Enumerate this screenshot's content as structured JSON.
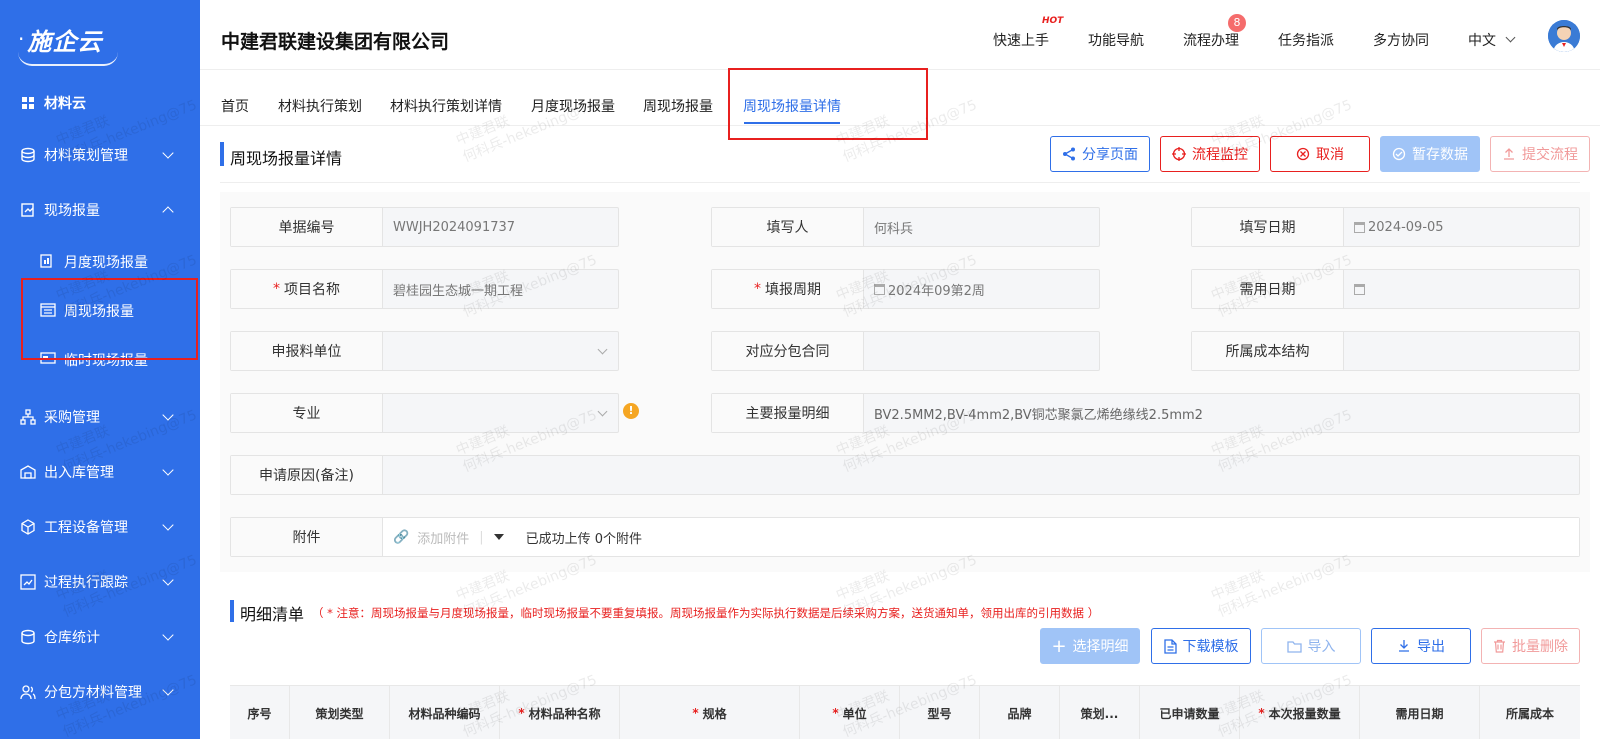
{
  "sidebar": {
    "logo": "施企云",
    "items": [
      {
        "label": "材料云"
      },
      {
        "label": "材料策划管理"
      },
      {
        "label": "现场报量"
      },
      {
        "label": "月度现场报量"
      },
      {
        "label": "周现场报量"
      },
      {
        "label": "临时现场报量"
      },
      {
        "label": "采购管理"
      },
      {
        "label": "出入库管理"
      },
      {
        "label": "工程设备管理"
      },
      {
        "label": "过程执行跟踪"
      },
      {
        "label": "仓库统计"
      },
      {
        "label": "分包方材料管理"
      }
    ]
  },
  "header": {
    "company": "中建君联建设集团有限公司",
    "nav": [
      "快速上手",
      "功能导航",
      "流程办理",
      "任务指派",
      "多方协同"
    ],
    "hot": "HOT",
    "badge": "8",
    "language": "中文"
  },
  "tabs": [
    "首页",
    "材料执行策划",
    "材料执行策划详情",
    "月度现场报量",
    "周现场报量",
    "周现场报量详情"
  ],
  "page": {
    "title": "周现场报量详情",
    "buttons": {
      "share": "分享页面",
      "monitor": "流程监控",
      "cancel": "取消",
      "save": "暂存数据",
      "submit": "提交流程"
    }
  },
  "form": {
    "doc_no": {
      "label": "单据编号",
      "value": "WWJH2024091737"
    },
    "filler": {
      "label": "填写人",
      "value": "何科兵"
    },
    "fill_date": {
      "label": "填写日期",
      "value": "2024-09-05"
    },
    "project": {
      "label": "项目名称",
      "value": "碧桂园生态城一期工程"
    },
    "period": {
      "label": "填报周期",
      "value": "2024年09第2周"
    },
    "need_date": {
      "label": "需用日期",
      "value": ""
    },
    "unit": {
      "label": "申报料单位",
      "value": ""
    },
    "contract": {
      "label": "对应分包合同",
      "value": ""
    },
    "cost": {
      "label": "所属成本结构",
      "value": ""
    },
    "major": {
      "label": "专业",
      "value": ""
    },
    "main_detail": {
      "label": "主要报量明细",
      "value": "BV2.5MM2,BV-4mm2,BV铜芯聚氯乙烯绝缘线2.5mm2"
    },
    "reason": {
      "label": "申请原因(备注)",
      "value": ""
    },
    "attach": {
      "label": "附件",
      "add": "添加附件",
      "status": "已成功上传 0个附件"
    }
  },
  "detail": {
    "title": "明细清单",
    "note": "（ * 注意：周现场报量与月度现场报量，临时现场报量不要重复填报。周现场报量作为实际执行数据是后续采购方案，送货通知单，领用出库的引用数据 ）",
    "buttons": {
      "select": "选择明细",
      "download": "下载模板",
      "import": "导入",
      "export": "导出",
      "batch_delete": "批量删除"
    },
    "columns": [
      "序号",
      "策划类型",
      "材料品种编码",
      "材料品种名称",
      "规格",
      "单位",
      "型号",
      "品牌",
      "策划...",
      "已申请数量",
      "本次报量数量",
      "需用日期",
      "所属成本"
    ]
  },
  "watermark": {
    "line1": "中建君联",
    "line2": "何科兵-hekebing@75"
  }
}
